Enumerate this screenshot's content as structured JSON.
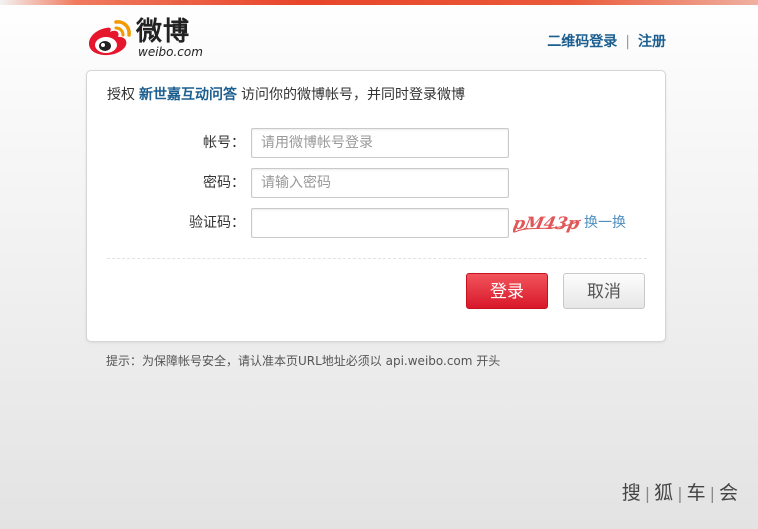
{
  "logo": {
    "cn": "微博",
    "en": "weibo.com"
  },
  "top_links": {
    "qrcode_login": "二维码登录",
    "separator": "|",
    "register": "注册"
  },
  "auth": {
    "prefix": "授权",
    "app_name": "新世嘉互动问答",
    "suffix": "访问你的微博帐号，并同时登录微博"
  },
  "form": {
    "account_label": "帐号：",
    "account_placeholder": "请用微博帐号登录",
    "account_value": "",
    "password_label": "密码：",
    "password_placeholder": "请输入密码",
    "password_value": "",
    "captcha_label": "验证码：",
    "captcha_value": "",
    "captcha_text": "pM43p",
    "refresh_label": "换一换"
  },
  "buttons": {
    "login": "登录",
    "cancel": "取消"
  },
  "hint": "提示：为保障帐号安全，请认准本页URL地址必须以 api.weibo.com 开头",
  "watermark": [
    "搜",
    "狐",
    "车",
    "会"
  ],
  "colors": {
    "accent_red": "#e8452a",
    "link_blue": "#1b5e8f",
    "login_button": "#e0202f"
  }
}
